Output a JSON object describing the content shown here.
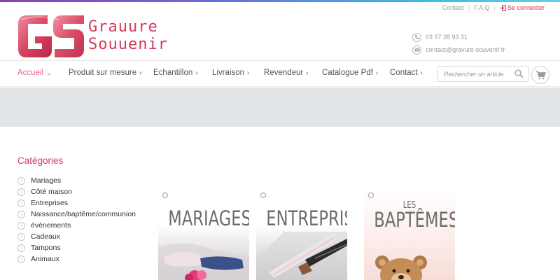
{
  "top_links": {
    "contact": "Contact",
    "faq": "F.A.Q",
    "login": "Se connecter",
    "separator": "|"
  },
  "logo": {
    "mark": "GS",
    "line1": "Grauure",
    "line2": "Souuenir",
    "color": "#d43a5c"
  },
  "contact_info": {
    "phone": "03 57 28 93 31",
    "email": "contact@gravure-souvenir.fr"
  },
  "nav": {
    "items": [
      {
        "label": "Accueil",
        "chevron": "⌄",
        "active": true
      },
      {
        "label": "Produit sur mesure",
        "chevron": "›"
      },
      {
        "label": "Echantillon",
        "chevron": "›"
      },
      {
        "label": "Livraison",
        "chevron": "›"
      },
      {
        "label": "Revendeur",
        "chevron": "›"
      },
      {
        "label": "Catalogue Pdf",
        "chevron": "›"
      },
      {
        "label": "Contact",
        "chevron": "›"
      }
    ],
    "search_placeholder": "Rechercher un article",
    "accent": "#e06b86"
  },
  "categories": {
    "title": "Catégories",
    "items": [
      "Mariages",
      "Côté maison",
      "Entreprises",
      "Naissance/baptême/communion",
      "évènements",
      "Cadeaux",
      "Tampons",
      "Animaux"
    ]
  },
  "tiles": [
    {
      "label_small": "",
      "label": "MARIAGES"
    },
    {
      "label_small": "",
      "label": "ENTREPRISES"
    },
    {
      "label_small": "LES",
      "label": "BAPTÊMES"
    }
  ],
  "icons": {
    "phone": "phone-icon",
    "email": "envelope-icon",
    "search": "search-icon",
    "cart": "cart-icon",
    "login": "login-icon"
  }
}
